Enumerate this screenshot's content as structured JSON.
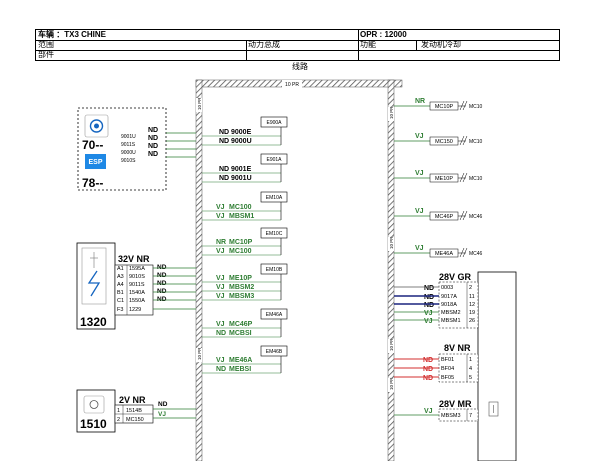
{
  "header": {
    "vehicle": "车辆 ：TX3 CHINE",
    "opr": "OPR : 12000",
    "scope": "范围",
    "scope_value": "动力总成",
    "function": "功能",
    "function_value": "发动机冷却",
    "part": "部件"
  },
  "title": "线路",
  "harness": {
    "top_code": "10 PR",
    "side_codes": [
      "10 PR",
      "10 PR",
      "10 PR",
      "10 PR",
      "10 PR",
      "10 PR"
    ]
  },
  "left_module": {
    "num_70": "70--",
    "num_78": "78--",
    "esp_label": "ESP",
    "wires": [
      "9001U",
      "9011S",
      "9000U",
      "9010S"
    ],
    "colors": [
      "ND",
      "ND",
      "ND",
      "ND"
    ]
  },
  "c1320": {
    "number": "1320",
    "connector": "32V NR",
    "pins": [
      {
        "pin": "A1",
        "wire": "1595A",
        "color": "ND"
      },
      {
        "pin": "A3",
        "wire": "9010S",
        "color": "ND"
      },
      {
        "pin": "A4",
        "wire": "9011S",
        "color": "ND"
      },
      {
        "pin": "B1",
        "wire": "1540A",
        "color": "ND"
      },
      {
        "pin": "C1",
        "wire": "1550A",
        "color": "ND"
      },
      {
        "pin": "F3",
        "wire": "1229",
        "color": ""
      }
    ]
  },
  "c1510": {
    "number": "1510",
    "connector": "2V NR",
    "pins": [
      {
        "pin": "1",
        "wire": "1514B",
        "color": "ND"
      },
      {
        "pin": "2",
        "wire": "MC150",
        "color": "VJ"
      }
    ]
  },
  "splices": [
    {
      "box": "E900A",
      "lines": [
        {
          "c": "ND",
          "w": "9000E"
        },
        {
          "c": "ND",
          "w": "9000U"
        }
      ]
    },
    {
      "box": "E901A",
      "lines": [
        {
          "c": "ND",
          "w": "9001E"
        },
        {
          "c": "ND",
          "w": "9001U"
        }
      ]
    },
    {
      "box": "EM10A",
      "lines": [
        {
          "c": "VJ",
          "w": "MC100"
        },
        {
          "c": "VJ",
          "w": "MBSM1"
        }
      ]
    },
    {
      "box": "EM10C",
      "lines": [
        {
          "c": "NR",
          "w": "MC10P"
        },
        {
          "c": "VJ",
          "w": "MC100"
        }
      ]
    },
    {
      "box": "EM10B",
      "lines": [
        {
          "c": "VJ",
          "w": "ME10P"
        },
        {
          "c": "VJ",
          "w": "MBSM2"
        },
        {
          "c": "VJ",
          "w": "MBSM3"
        }
      ]
    },
    {
      "box": "EM46A",
      "lines": [
        {
          "c": "VJ",
          "w": "MC46P"
        },
        {
          "c": "ND",
          "w": "MCBSI"
        }
      ]
    },
    {
      "box": "EM46B",
      "lines": [
        {
          "c": "VJ",
          "w": "ME46A"
        },
        {
          "c": "ND",
          "w": "MEBSI"
        }
      ]
    }
  ],
  "grounds": [
    {
      "color": "NR",
      "wire": "MC10P",
      "label": "MC10"
    },
    {
      "color": "VJ",
      "wire": "MC150",
      "label": "MC10"
    },
    {
      "color": "VJ",
      "wire": "ME10P",
      "label": "MC10"
    },
    {
      "color": "VJ",
      "wire": "MC46P",
      "label": "MC46"
    },
    {
      "color": "VJ",
      "wire": "ME46A",
      "label": "MC46"
    }
  ],
  "c28gr": {
    "connector": "28V GR",
    "rows": [
      {
        "color": "ND",
        "wire": "0003",
        "pin": "2"
      },
      {
        "color": "ND",
        "wire": "9017A",
        "pin": "11"
      },
      {
        "color": "ND",
        "wire": "9018A",
        "pin": "12"
      },
      {
        "color": "VJ",
        "wire": "MBSM2",
        "pin": "19"
      },
      {
        "color": "VJ",
        "wire": "MBSM1",
        "pin": "26"
      }
    ]
  },
  "c8nr": {
    "connector": "8V NR",
    "rows": [
      {
        "color": "ND",
        "wire": "BF01",
        "pin": "1"
      },
      {
        "color": "ND",
        "wire": "BF04",
        "pin": "4"
      },
      {
        "color": "ND",
        "wire": "BF05",
        "pin": "5"
      }
    ]
  },
  "c28mr": {
    "connector": "28V MR",
    "rows": [
      {
        "color": "VJ",
        "wire": "MBSM3",
        "pin": "7"
      }
    ]
  },
  "colors": {
    "green": "#2e7d32",
    "red": "#d32f2f",
    "blue": "#1a237e",
    "hatch": "#555555"
  }
}
